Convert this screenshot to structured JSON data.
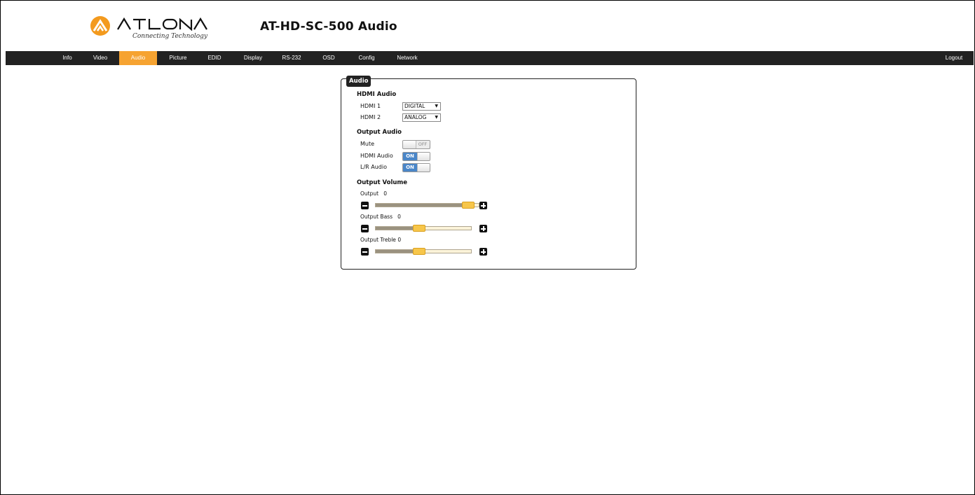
{
  "header": {
    "brand": "ATLONA",
    "brand_tagline": "Connecting Technology",
    "title": "AT-HD-SC-500  Audio"
  },
  "nav": {
    "items": [
      "Info",
      "Video",
      "Audio",
      "Picture",
      "EDID",
      "Display",
      "RS-232",
      "OSD",
      "Config",
      "Network"
    ],
    "active": "Audio",
    "logout": "Logout"
  },
  "panel": {
    "tab_label": "Audio",
    "hdmi_audio": {
      "heading": "HDMI Audio",
      "hdmi1_label": "HDMI 1",
      "hdmi1_value": "DIGITAL",
      "hdmi2_label": "HDMI 2",
      "hdmi2_value": "ANALOG"
    },
    "output_audio": {
      "heading": "Output Audio",
      "mute_label": "Mute",
      "mute_state": "OFF",
      "hdmi_audio_label": "HDMI Audio",
      "hdmi_audio_state": "ON",
      "lr_audio_label": "L/R Audio",
      "lr_audio_state": "ON"
    },
    "output_volume": {
      "heading": "Output Volume",
      "output_label": "Output",
      "output_value": "0",
      "output_slider_fraction": 0.95,
      "bass_label": "Output Bass",
      "bass_value": "0",
      "bass_slider_fraction": 0.45,
      "treble_label": "Output Treble",
      "treble_value": "0",
      "treble_slider_fraction": 0.45
    }
  },
  "colors": {
    "accent": "#f6a331",
    "nav_bg": "#222222",
    "toggle_on": "#4a86c8",
    "slider_handle": "#f7c64a"
  }
}
